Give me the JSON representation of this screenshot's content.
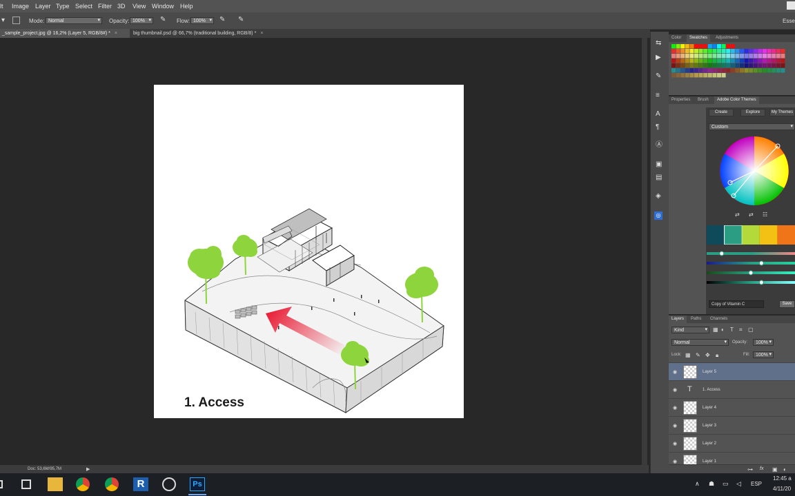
{
  "menu": [
    "lt",
    "Image",
    "Layer",
    "Type",
    "Select",
    "Filter",
    "3D",
    "View",
    "Window",
    "Help"
  ],
  "options": {
    "mode_label": "Mode:",
    "mode_value": "Normal",
    "opacity_label": "Opacity:",
    "opacity_value": "100%",
    "flow_label": "Flow:",
    "flow_value": "100%",
    "workspace": "Esse"
  },
  "tabs": [
    {
      "title": "_sample_project.jpg @ 16,2% (Layer 5, RGB/8#) *",
      "close": "×"
    },
    {
      "title": "big thumbnail.psd @ 66,7% (traditional building, RGB/8) *",
      "close": "×"
    }
  ],
  "canvas": {
    "caption": "1. Access"
  },
  "status": {
    "doc": "Doc: 53,6M/95,7M",
    "arrow": "▶"
  },
  "swatches_panel": {
    "tabs": [
      "Color",
      "Swatches",
      "Adjustments"
    ],
    "active": "Swatches"
  },
  "color_themes_panel": {
    "tabs": [
      "Properties",
      "Brush",
      "Adobe Color Themes"
    ],
    "subtabs": [
      "Create",
      "Explore",
      "My Themes"
    ],
    "rule": "Custom",
    "theme_name": "Copy of Vitamin C",
    "save": "Save",
    "theme_colors": [
      "#0f4a5a",
      "#2a9d82",
      "#b4d93a",
      "#f2c114",
      "#f07418"
    ],
    "sliders": [
      0.17,
      0.62,
      0.5,
      0.62
    ]
  },
  "layers_panel": {
    "tabs": [
      "Layers",
      "Paths",
      "Channels"
    ],
    "kind": "Kind",
    "blend": "Normal",
    "opacity_label": "Opacity:",
    "opacity_value": "100%",
    "lock_label": "Lock:",
    "fill_label": "Fill:",
    "fill_value": "100%",
    "layers": [
      {
        "name": "Layer 5",
        "type": "pixel",
        "selected": true
      },
      {
        "name": "1. Access",
        "type": "text",
        "selected": false
      },
      {
        "name": "Layer 4",
        "type": "pixel",
        "selected": false
      },
      {
        "name": "Layer 3",
        "type": "pixel",
        "selected": false
      },
      {
        "name": "Layer 2",
        "type": "pixel",
        "selected": false
      },
      {
        "name": "Layer 1",
        "type": "pixel",
        "selected": false
      }
    ],
    "text_layer_glyph": "T",
    "fx": "fx"
  },
  "taskbar": {
    "lang": "ESP",
    "time": "12:45 a",
    "date": "4/11/20",
    "revit_letter": "R",
    "ps_letter": "Ps"
  },
  "colors": {
    "accent_selected": "#60708a",
    "arrow_red": "#e8102a",
    "tree_green": "#8ed43c"
  }
}
